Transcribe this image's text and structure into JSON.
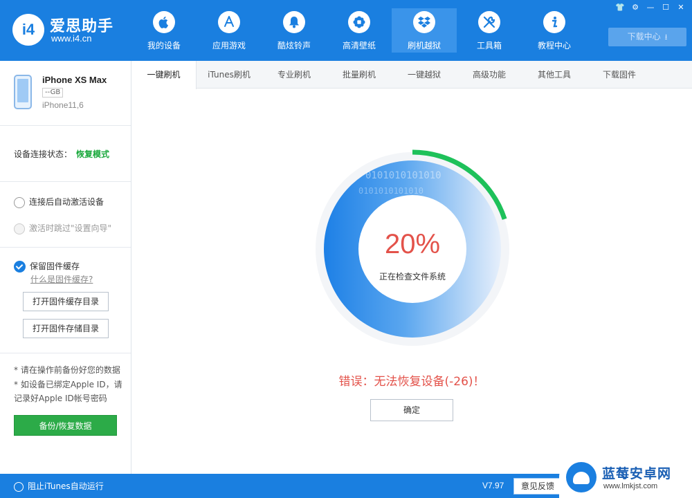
{
  "app": {
    "logo_badge": "i4",
    "logo_name": "爱思助手",
    "logo_url": "www.i4.cn"
  },
  "nav": [
    {
      "label": "我的设备",
      "icon": "apple-icon"
    },
    {
      "label": "应用游戏",
      "icon": "app-store-icon"
    },
    {
      "label": "酷炫铃声",
      "icon": "bell-icon"
    },
    {
      "label": "高清壁纸",
      "icon": "flower-icon"
    },
    {
      "label": "刷机越狱",
      "icon": "dropbox-icon"
    },
    {
      "label": "工具箱",
      "icon": "tools-icon"
    },
    {
      "label": "教程中心",
      "icon": "info-icon"
    }
  ],
  "window_controls": {
    "skin": "👕",
    "settings": "⚙",
    "min": "—",
    "max": "☐",
    "close": "✕"
  },
  "download_center": {
    "label": "下载中心",
    "icon": "⭳"
  },
  "device": {
    "name": "iPhone XS Max",
    "capacity": "--GB",
    "model": "iPhone11,6"
  },
  "connection": {
    "label": "设备连接状态：",
    "value": "恢复模式"
  },
  "options": {
    "auto_activate": "连接后自动激活设备",
    "skip_setup": "激活时跳过\"设置向导\"",
    "keep_firmware": "保留固件缓存",
    "what_is_cache": "什么是固件缓存?",
    "open_cache_dir": "打开固件缓存目录",
    "open_storage_dir": "打开固件存储目录"
  },
  "notes": [
    "* 请在操作前备份好您的数据",
    "* 如设备已绑定Apple ID，请记录好Apple ID帐号密码"
  ],
  "backup_button": "备份/恢复数据",
  "tabs": [
    "一键刷机",
    "iTunes刷机",
    "专业刷机",
    "批量刷机",
    "一键越狱",
    "高级功能",
    "其他工具",
    "下载固件"
  ],
  "progress": {
    "percent_text": "20%",
    "fraction": 0.2,
    "status": "正在检查文件系统",
    "binary_text": "0101010101010"
  },
  "error": {
    "message": "错误：无法恢复设备(-26)！"
  },
  "confirm_button": "确定",
  "footer": {
    "itunes_toggle": "阻止iTunes自动运行",
    "version": "V7.97",
    "feedback": "意见反馈"
  },
  "watermark": {
    "title": "蓝莓安卓网",
    "url": "www.lmkjst.com"
  },
  "colors": {
    "brand": "#1a7fe0",
    "success": "#2cab48",
    "error": "#e3524a",
    "progress": "#1ec15a"
  }
}
